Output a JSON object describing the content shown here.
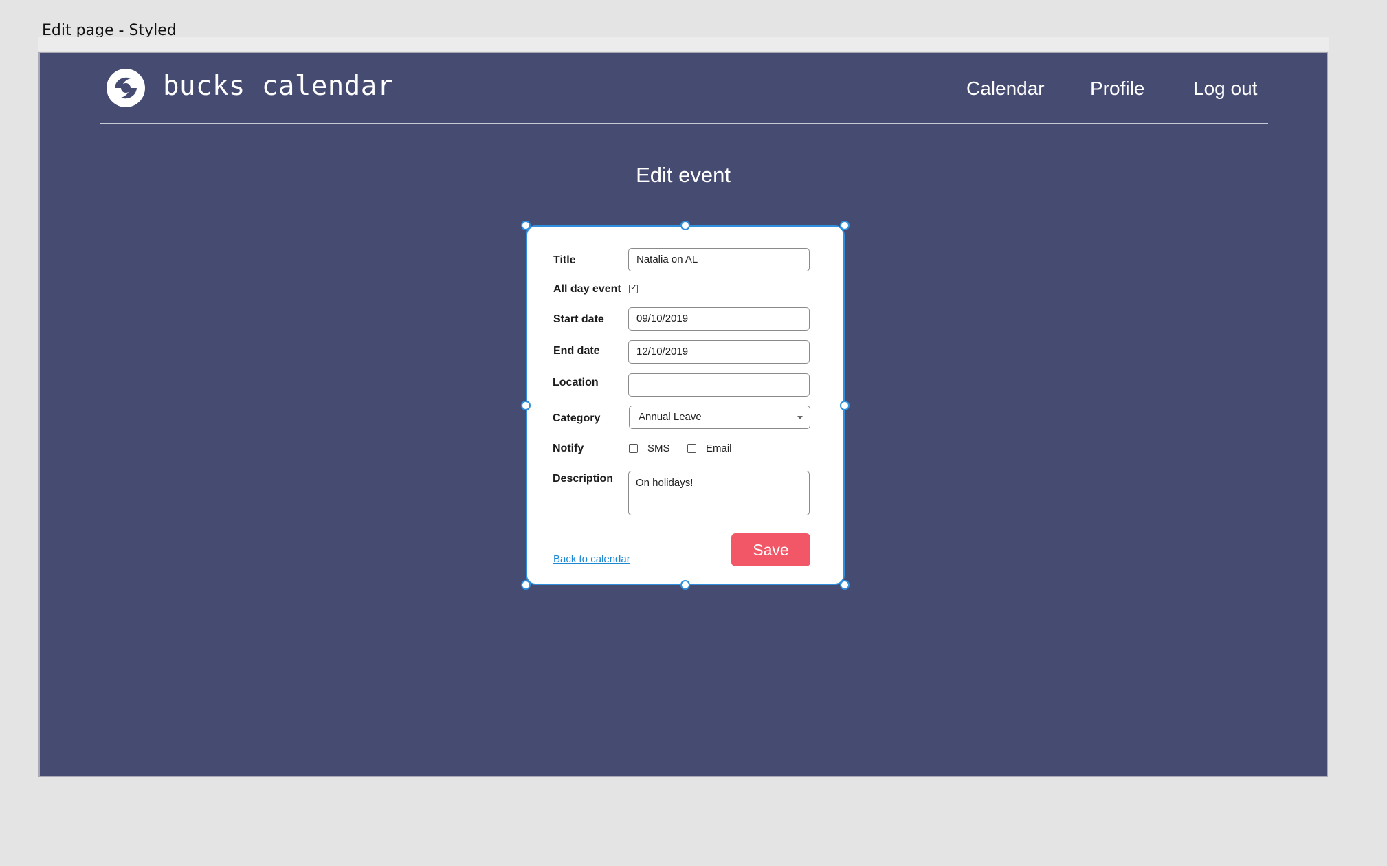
{
  "frame": {
    "title": "Edit page - Styled"
  },
  "header": {
    "brand": "bucks calendar",
    "logo_icon": "bucks-logo-icon",
    "nav": [
      "Calendar",
      "Profile",
      "Log out"
    ]
  },
  "page": {
    "heading": "Edit event"
  },
  "form": {
    "title_label": "Title",
    "title_value": "Natalia on AL",
    "all_day_label": "All day event",
    "all_day_checked": true,
    "start_label": "Start date",
    "start_value": "09/10/2019",
    "end_label": "End date",
    "end_value": "12/10/2019",
    "location_label": "Location",
    "location_value": "",
    "category_label": "Category",
    "category_value": "Annual Leave",
    "notify_label": "Notify",
    "notify_options": [
      {
        "label": "SMS",
        "checked": false
      },
      {
        "label": "Email",
        "checked": false
      }
    ],
    "description_label": "Description",
    "description_value": "On holidays!",
    "back_link": "Back to calendar",
    "save_label": "Save"
  },
  "colors": {
    "background": "#464b72",
    "accent_button": "#f25767",
    "link": "#1e88d0",
    "selection": "#2f8fdc"
  }
}
